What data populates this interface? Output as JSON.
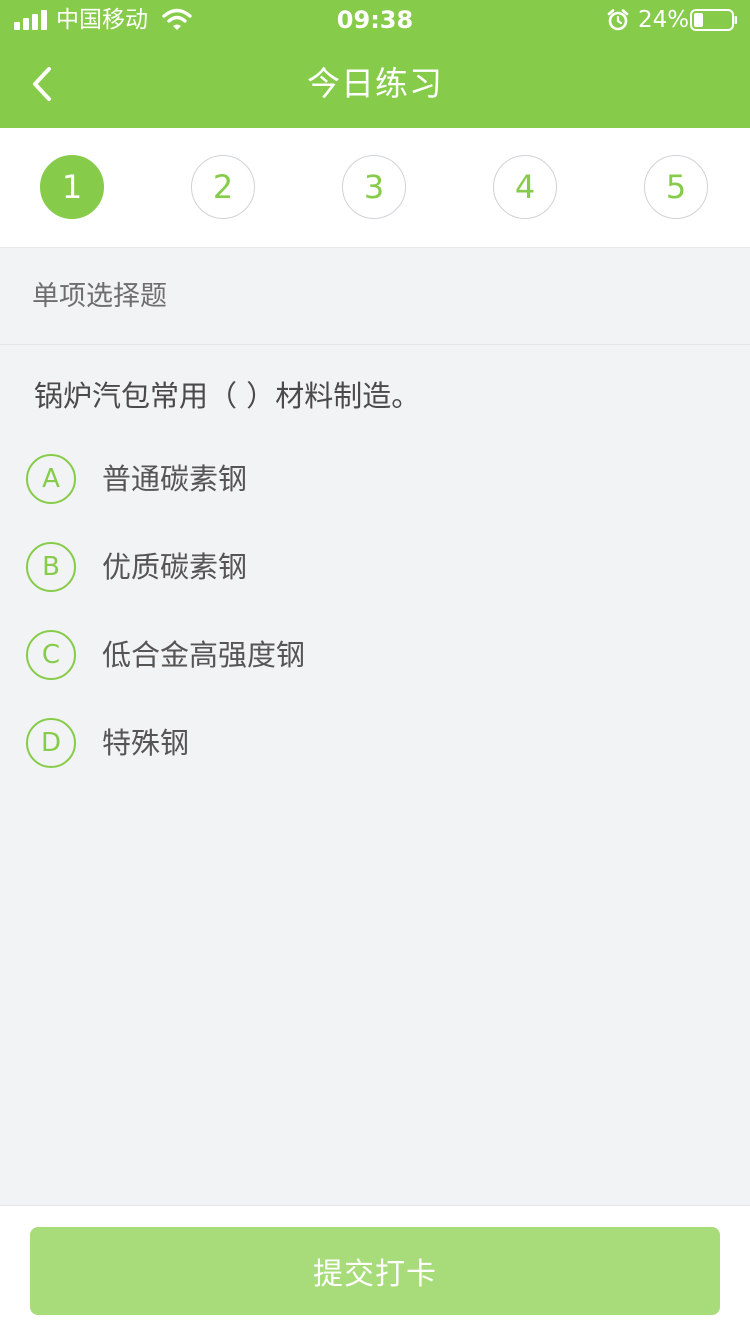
{
  "status_bar": {
    "carrier": "中国移动",
    "time": "09:38",
    "battery": "24%",
    "icons": [
      "signal-icon",
      "wifi-icon",
      "alarm-icon",
      "battery-icon"
    ]
  },
  "nav": {
    "title": "今日练习",
    "back_icon": "chevron-left-icon"
  },
  "tabs": [
    {
      "label": "1",
      "active": true
    },
    {
      "label": "2",
      "active": false
    },
    {
      "label": "3",
      "active": false
    },
    {
      "label": "4",
      "active": false
    },
    {
      "label": "5",
      "active": false
    }
  ],
  "question": {
    "type": "单项选择题",
    "text": "锅炉汽包常用（   ）材料制造。",
    "options": [
      {
        "letter": "A",
        "text": "普通碳素钢"
      },
      {
        "letter": "B",
        "text": "优质碳素钢"
      },
      {
        "letter": "C",
        "text": "低合金高强度钢"
      },
      {
        "letter": "D",
        "text": "特殊钢"
      }
    ]
  },
  "footer": {
    "submit_label": "提交打卡"
  },
  "colors": {
    "brand_green": "#86cc4a",
    "submit_disabled": "#a8dc7b",
    "background": "#f2f3f5"
  }
}
